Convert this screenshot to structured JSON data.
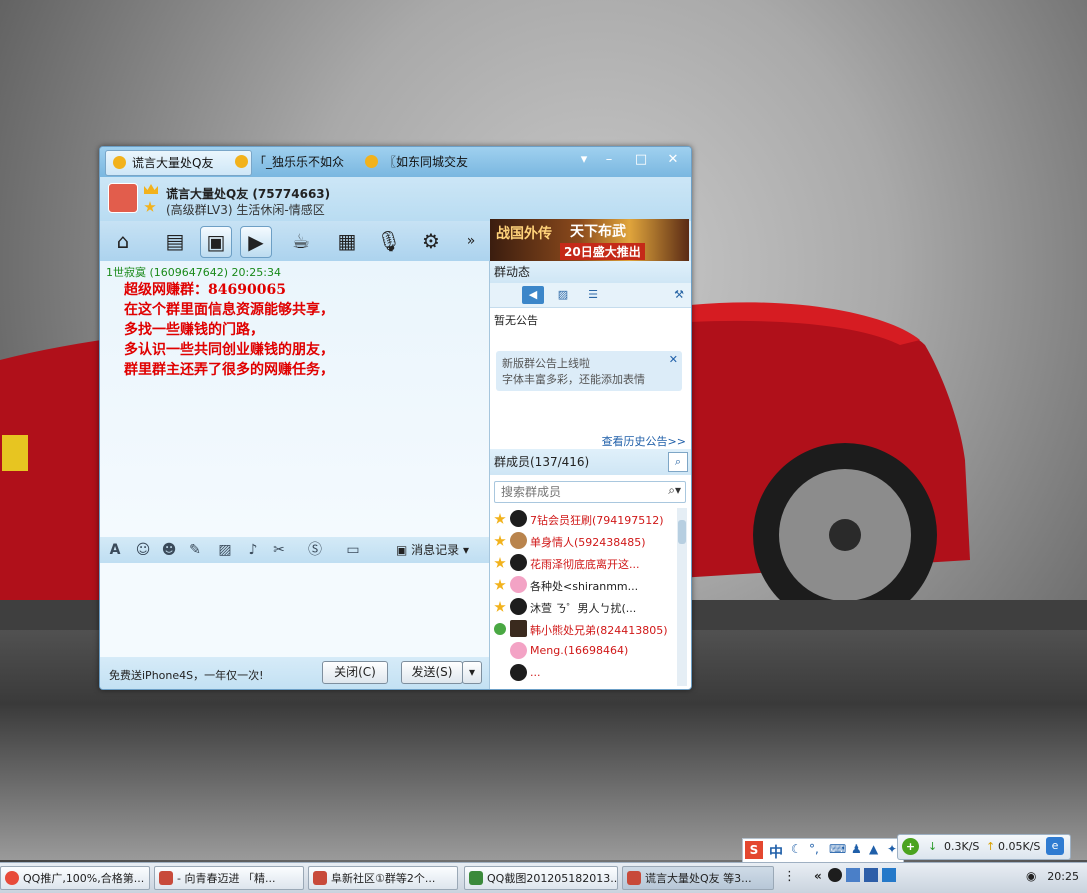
{
  "window": {
    "tabs": [
      {
        "label": "谎言大量处Q友"
      },
      {
        "label": "「_独乐乐不如众"
      },
      {
        "label": "〖如东同城交友"
      }
    ]
  },
  "group": {
    "title": "谎言大量处Q友   (75774663)",
    "subtitle": "(高级群LV3) 生活休闲-情感区"
  },
  "banner": {
    "text1": "战国外传",
    "text2": "20日盛大推出",
    "text3": "天下布武"
  },
  "message": {
    "sender": "1世寂寞 (1609647642)   20:25:34",
    "lines": [
      "超级网赚群：84690065",
      "在这个群里面信息资源能够共享，",
      "多找一些赚钱的门路，",
      "多认识一些共同创业赚钱的朋友，",
      "群里群主还弄了很多的网赚任务，"
    ]
  },
  "editor_toolbar": {
    "history_label": "消息记录"
  },
  "footer": {
    "ad_text": "免费送iPhone4S，一年仅一次!",
    "close_label": "关闭(C)",
    "send_label": "发送(S)"
  },
  "side": {
    "dynamics_title": "群动态",
    "no_notice": "暂无公告",
    "new_notice_line1": "新版群公告上线啦",
    "new_notice_line2": "字体丰富多彩，还能添加表情",
    "history_link": "查看历史公告>>",
    "members_title": "群成员(137/416)",
    "search_placeholder": "搜索群成员",
    "members": [
      {
        "name": "7钻会员狂刷(794197512)",
        "color": "#d01818"
      },
      {
        "name": "单身情人(592438485)",
        "color": "#d01818"
      },
      {
        "name": "花雨泽彻底底离开这...",
        "color": "#d01818"
      },
      {
        "name": "          各种处<shiranmm...",
        "color": "#222222"
      },
      {
        "name": "沐萱          ㄋ゜男人ㄅ扰(...",
        "color": "#222222"
      },
      {
        "name": "韩小熊处兄弟(824413805)",
        "color": "#d01818"
      },
      {
        "name": "                  Meng.(16698464)",
        "color": "#d01818"
      },
      {
        "name": "                               ...",
        "color": "#d01818"
      }
    ]
  },
  "taskbar": {
    "tasks": [
      {
        "label": "QQ推广,100%,合格第..."
      },
      {
        "label": "- 向青春迈进 「精..."
      },
      {
        "label": "阜新社区①群等2个..."
      },
      {
        "label": "QQ截图201205182013..."
      },
      {
        "label": "谎言大量处Q友   等3..."
      }
    ],
    "clock": "20:25"
  },
  "netmon": {
    "down": "0.3K/S",
    "up": "0.05K/S"
  },
  "ime": {
    "mode": "中"
  }
}
